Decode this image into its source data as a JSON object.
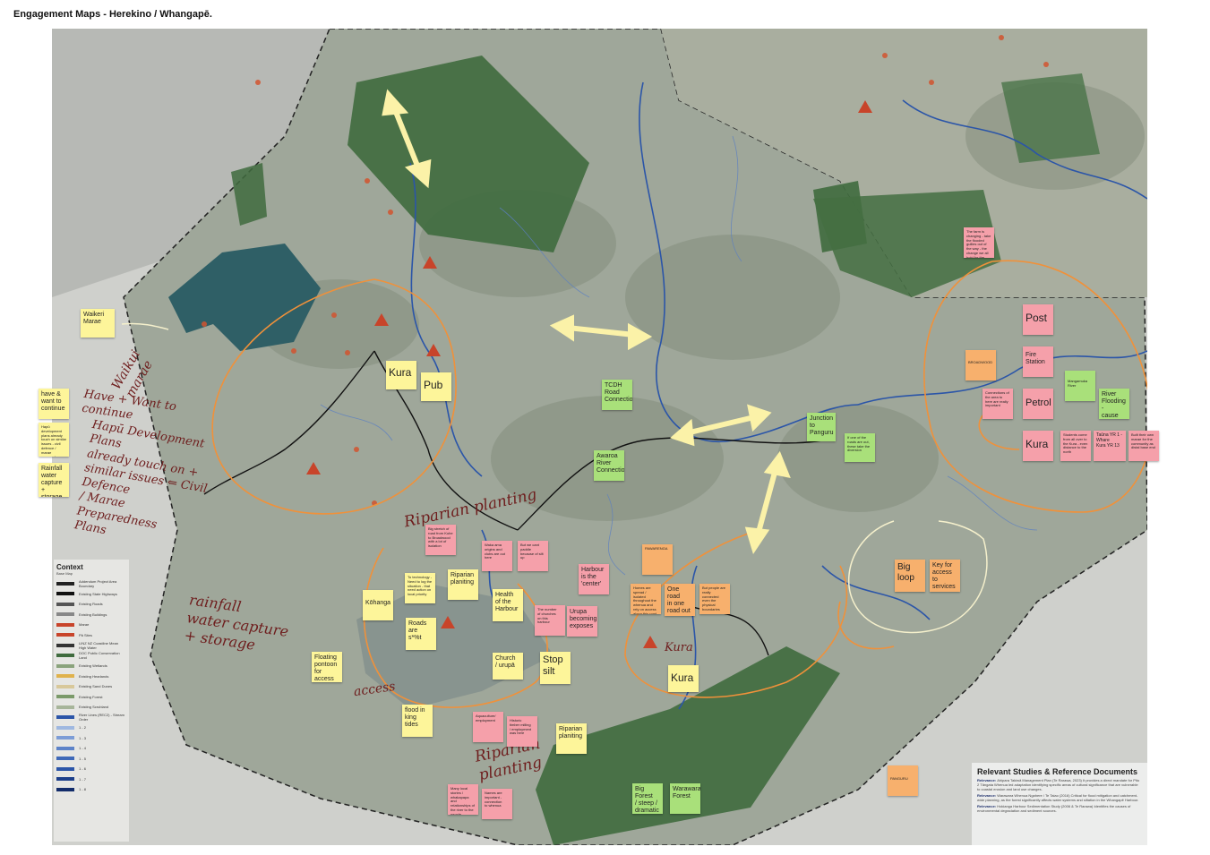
{
  "page": {
    "title": "Engagement Maps - Herekino / Whangapē."
  },
  "colors": {
    "sticky_yellow": "#fdf59a",
    "sticky_green": "#a9e07a",
    "sticky_pink": "#f5a0aa",
    "sticky_orange": "#f7b06d",
    "forest": "#3f6b3e",
    "river": "#2b55a8",
    "marker_pen": "#f0913a",
    "double_arrow": "#fbf2a8"
  },
  "notes": {
    "waikeri_marae": "Waikeri\nMarae",
    "kura_west": "Kura",
    "pub": "Pub",
    "have_want_continue": "have &\nwant to\ncontinue",
    "hapu_dev_plan_note": "Hapū development plans already touch on similar issues - civil defence / marae preparedness plans",
    "rainfall_storage": "Rainfall\nwater\ncapture +\nstorage",
    "tcdh_road": "TCDH\nRoad\nConnection",
    "awaroa_river": "Awaroa\nRiver\nConnection",
    "junction_panguru": "Junction\nto\nPanguru",
    "roads_out_diversion": "If one of the roads are out, these take the diversion",
    "big_stretch": "Big stretch of road from Kohe to Broadwood with a lot of isolation",
    "waka_ama": "Waka ama origins and clubs are out here",
    "paddle_silt": "But we cant paddle because of silt up",
    "harbour_center": "Harbour\nis the\n'center'",
    "to_technology": "To technology - Need to log the situation - that need action on local priority",
    "riparian_1": "Riparian\nplaniting",
    "kohanga": "Kōhanga",
    "health_harbour": "Health\nof the\nHarbour",
    "churches_harbour": "The number\nof churches\non this\nharbour",
    "urupa_exposes": "Urupa\nbecoming\nexposes",
    "roads_are": "Roads\nare\ns*%t",
    "church_urupa": "Church\n/ urupā",
    "stop_silt": "Stop\nsilt",
    "floating_pontoon": "Floating\npontoon\nfor access",
    "flood_king_tides": "flood in\nking\ntides",
    "aquaculture": "Aquaculture/\nemployment",
    "historic_timber": "Historic\ntimber milling\n/ employment\nwas here",
    "riparian_2": "Riparian\nplaniting",
    "many_local_stories": "Many local stories / whakapapa and relationships of the river to the people",
    "names_connection": "Names are\nimportant -\nconnection\nto whenua",
    "pawarenga": "PAWARENGA",
    "homes_spread": "Homes are spread / isolated throughout the whenua and rely on access along this road",
    "one_road": "One road\nin one\nroad out",
    "not_connected": "But people are really connected even the physical boundaries",
    "kura_south": "Kura",
    "big_forest": "Big Forest\n/ steep /\ndramatic",
    "warawara_forest": "Warawara\nForest",
    "big_loop": "Big\nloop",
    "key_access": "Key for\naccess to\nservices",
    "climate_note": "The farm is changing - take the flooded gullies out of the way - the change we all hold for the changes",
    "broadwood": "BROADWOOD",
    "post": "Post",
    "fire_station": "Fire\nStation",
    "connections_area": "Connections of the area to here are really important",
    "petrol": "Petrol",
    "kura_east": "Kura",
    "students_north": "Students come from all over to the Kura - even distance to the north",
    "mangamuka_river": "Mangamuka River",
    "river_flooding": "River\nFlooding -\ncause road\nfailures",
    "tauna_yr": "Taūna YR 1 -\nWhare\nKura YR 13",
    "built_own_marae": "Built their own marae for the community as distal base end",
    "panguru": "PANGURU"
  },
  "handwriting": {
    "waikui_marae": "Waikui\nmarae",
    "have_want": "Have + Want to\ncontinue",
    "hapu_plans": "Hapū Development\nPlans\nalready touch on +\nsimilar issues ⇐ Civil\nDefence\n/ Marae\nPreparedness\nPlans",
    "rainfall": "rainfall\nwater capture\n+ storage",
    "riparian_planting_top": "Riparian planting",
    "riparian_planting_bottom": "Riparian\nplanting",
    "kura_map": "Kura",
    "access": "access"
  },
  "legend": {
    "title": "Context",
    "subtitle": "Base Map",
    "items": [
      {
        "label": "Addendum Project Area Boundary",
        "color": "#222222"
      },
      {
        "label": "Existing State Highways",
        "color": "#111111"
      },
      {
        "label": "Existing Roads",
        "color": "#555555"
      },
      {
        "label": "Existing Buildings",
        "color": "#888888"
      },
      {
        "label": "Marae",
        "color": "#c8442a"
      },
      {
        "label": "Pā Sites",
        "color": "#c8442a"
      },
      {
        "label": "LINZ NZ Coastline Mean High Water",
        "color": "#333333"
      },
      {
        "label": "DOC Public Conservation Land",
        "color": "#3f6b3e"
      },
      {
        "label": "Existing Wetlands",
        "color": "#8aa37c"
      },
      {
        "label": "Existing Hearlands",
        "color": "#e0b24c"
      },
      {
        "label": "Existing Sand Dunes",
        "color": "#d8c89a"
      },
      {
        "label": "Existing Forest",
        "color": "#7b9a6a"
      },
      {
        "label": "Existing Scrubland",
        "color": "#a7b59a"
      },
      {
        "label": "River Lines (REC2) - Stream Order",
        "color": "#2b55a8"
      },
      {
        "label": "1 - 2",
        "color": "#9fb8e0"
      },
      {
        "label": "1 - 3",
        "color": "#7d9dd6"
      },
      {
        "label": "1 - 4",
        "color": "#5d83c8"
      },
      {
        "label": "1 - 5",
        "color": "#3f69b8"
      },
      {
        "label": "1 - 6",
        "color": "#2b55a8"
      },
      {
        "label": "1 - 7",
        "color": "#1c3f8a"
      },
      {
        "label": "1 - 8",
        "color": "#122c6a"
      }
    ]
  },
  "references": {
    "title": "Relevant Studies & Reference Documents",
    "lines": [
      {
        "heading": "Relevance:",
        "text": "Ahipara Takiwā Management Plan (Te Rarawa, 2023) It provides a direct mandate for Pito 2 Tāngata Whenua led adaptation identifying specific areas of cultural significance that are vulnerable to coastal erosion and land use changes."
      },
      {
        "heading": "Relevance:",
        "text": "Warawara Whenua Ngahere / Te Taiao (2016) Critical for flood mitigation and catchment-wide planning, as the forest significantly affects water systems and siltation in the Whangapē Harbour."
      },
      {
        "heading": "Relevance:",
        "text": "Hokianga Harbour Sedimentation Study (2006 & Te Rarawa) Identifies the causes of environmental degradation and sediment sources."
      }
    ]
  }
}
